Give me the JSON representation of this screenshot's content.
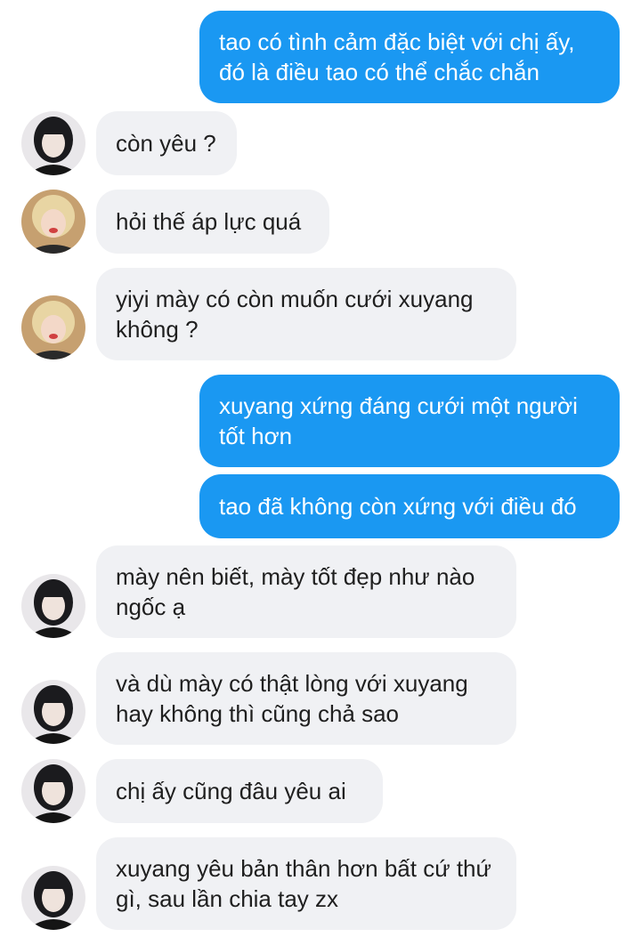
{
  "messages": [
    {
      "side": "out",
      "text": "tao có tình cảm đặc biệt với chị ấy, đó là điều tao có thể chắc chắn"
    },
    {
      "side": "in",
      "sender": "dark-hair",
      "text": "còn yêu ?"
    },
    {
      "side": "in",
      "sender": "blonde-hair",
      "text": "hỏi thế áp lực quá"
    },
    {
      "side": "in",
      "sender": "blonde-hair",
      "text": "yiyi mày có còn muốn cưới xuyang không ?"
    },
    {
      "side": "out",
      "text": "xuyang xứng đáng cưới một người tốt hơn"
    },
    {
      "side": "out",
      "text": "tao đã không còn xứng với điều đó"
    },
    {
      "side": "in",
      "sender": "dark-hair",
      "text": "mày nên biết, mày tốt đẹp như nào ngốc ạ"
    },
    {
      "side": "in",
      "sender": "dark-hair",
      "text": "và dù mày có thật lòng với xuyang hay không thì cũng chả sao"
    },
    {
      "side": "in",
      "sender": "dark-hair",
      "text": "chị ấy cũng đâu yêu ai"
    },
    {
      "side": "in",
      "sender": "dark-hair",
      "text": "xuyang yêu bản thân hơn bất cứ thứ gì, sau lần chia tay zx"
    }
  ],
  "colors": {
    "outgoing_bubble": "#1a98f2",
    "incoming_bubble": "#f0f1f4",
    "outgoing_text": "#ffffff",
    "incoming_text": "#1f1f1f"
  }
}
